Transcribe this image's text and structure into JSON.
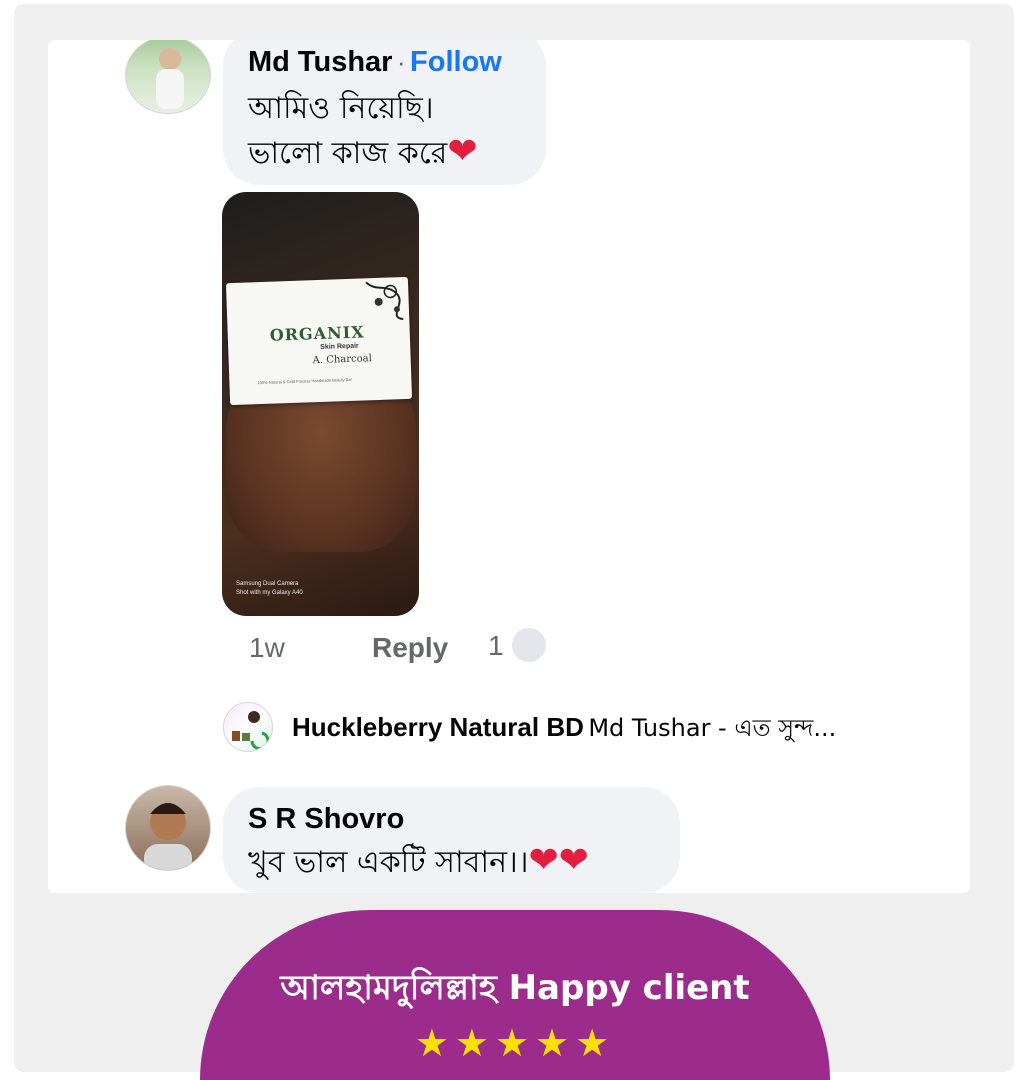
{
  "comment1": {
    "author": "Md Tushar",
    "separator": "·",
    "follow_label": "Follow",
    "lines": [
      "আমিও নিয়েছি।",
      "ভালো কাজ করে"
    ],
    "heart": "❤",
    "photo": {
      "brand": "ORGANIX",
      "sub": "Skin Repair",
      "variant": "A. Charcoal",
      "tagline": "100% Natural & Cold Process Handmade Beauty Bar",
      "camera_line1": "Samsung Dual Camera",
      "camera_line2": "Shot with my Galaxy A40"
    },
    "time": "1w",
    "reply_label": "Reply",
    "reaction_count": "1"
  },
  "reply": {
    "author": "Huckleberry Natural BD",
    "text": "Md Tushar - এত সুন্দ..."
  },
  "comment2": {
    "author": "S R Shovro",
    "text": "খুব ভাল একটি সাবান।।",
    "hearts": "❤❤"
  },
  "banner": {
    "title": "আলহামদুলিল্লাহ Happy client",
    "stars": "★★★★★",
    "color": "#9b2c8c",
    "star_color": "#ffe000"
  }
}
